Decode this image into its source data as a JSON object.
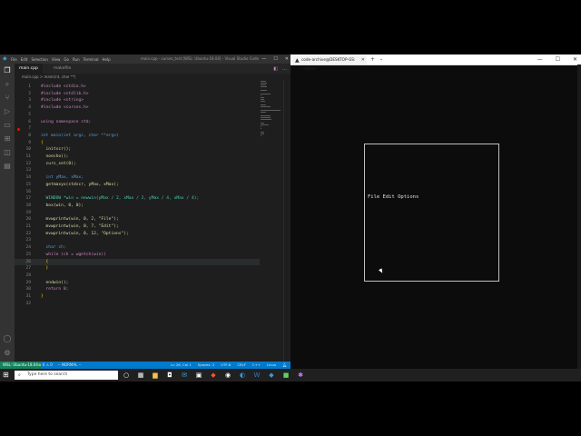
{
  "vscode": {
    "window_title": "main.cpp - curses_test [WSL: Ubuntu-18.04] - Visual Studio Code",
    "menu": [
      "File",
      "Edit",
      "Selection",
      "View",
      "Go",
      "Run",
      "Terminal",
      "Help"
    ],
    "tabs": [
      {
        "label": "main.cpp",
        "active": true
      },
      {
        "label": "makefile",
        "active": false
      }
    ],
    "breadcrumb": "main.cpp > main(int, char **)",
    "code": [
      {
        "n": "1",
        "t": "#include <stdio.h>"
      },
      {
        "n": "2",
        "t": "#include <stdlib.h>"
      },
      {
        "n": "3",
        "t": "#include <string>"
      },
      {
        "n": "4",
        "t": "#include <curses.h>"
      },
      {
        "n": "5",
        "t": ""
      },
      {
        "n": "6",
        "t": "using namespace std;"
      },
      {
        "n": "7",
        "t": ""
      },
      {
        "n": "8",
        "t": "int main(int argc, char **argv)"
      },
      {
        "n": "9",
        "t": "{"
      },
      {
        "n": "10",
        "t": "  initscr();"
      },
      {
        "n": "11",
        "t": "  noecho();"
      },
      {
        "n": "12",
        "t": "  curs_set(0);"
      },
      {
        "n": "13",
        "t": ""
      },
      {
        "n": "14",
        "t": "  int yMax, xMax;"
      },
      {
        "n": "15",
        "t": "  getmaxyx(stdscr, yMax, xMax);"
      },
      {
        "n": "16",
        "t": ""
      },
      {
        "n": "17",
        "t": "  WINDOW *win = newwin(yMax / 2, xMax / 2, yMax / 4, xMax / 4);"
      },
      {
        "n": "18",
        "t": "  box(win, 0, 0);"
      },
      {
        "n": "19",
        "t": ""
      },
      {
        "n": "20",
        "t": "  mvwprintw(win, 0, 2, \"File\");"
      },
      {
        "n": "21",
        "t": "  mvwprintw(win, 0, 7, \"Edit\");"
      },
      {
        "n": "22",
        "t": "  mvwprintw(win, 0, 12, \"Options\");"
      },
      {
        "n": "23",
        "t": ""
      },
      {
        "n": "24",
        "t": "  char ch;"
      },
      {
        "n": "25",
        "t": "  while (ch = wgetch(win))"
      },
      {
        "n": "26",
        "t": "  {"
      },
      {
        "n": "27",
        "t": "  }"
      },
      {
        "n": "28",
        "t": ""
      },
      {
        "n": "29",
        "t": "  endwin();"
      },
      {
        "n": "30",
        "t": "  return 0;"
      },
      {
        "n": "31",
        "t": "}"
      },
      {
        "n": "32",
        "t": ""
      }
    ],
    "status": {
      "remote": "WSL: Ubuntu-18.04",
      "problems": "⊗ 0  ⚠ 0",
      "mode": "-- NORMAL --",
      "position": "Ln 26, Col 1",
      "spaces": "Spaces: 2",
      "encoding": "UTF-8",
      "eol": "CRLF",
      "language": "C++",
      "platform": "Linux"
    }
  },
  "terminal": {
    "tab_title": "code-archive@DESKTOP-GS: ~/tutori",
    "ncurses_menu": "File Edit Options"
  },
  "taskbar": {
    "search_placeholder": "Type here to search"
  },
  "colors": {
    "accent": "#007acc",
    "remote": "#16825d",
    "breakpoint": "#e51400"
  }
}
